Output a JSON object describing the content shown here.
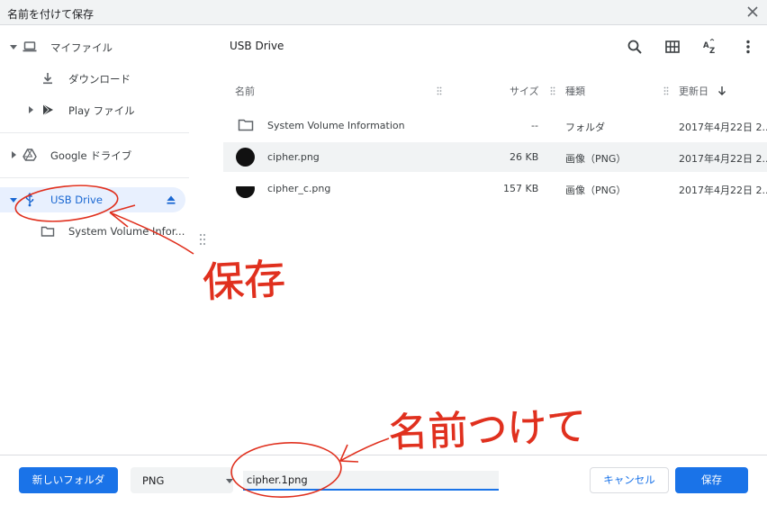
{
  "dialog": {
    "title": "名前を付けて保存"
  },
  "sidebar": {
    "items": [
      {
        "label": "マイファイル"
      },
      {
        "label": "ダウンロード"
      },
      {
        "label": "Play ファイル"
      },
      {
        "label": "Google ドライブ"
      },
      {
        "label": "USB Drive"
      },
      {
        "label": "System Volume Infor..."
      }
    ]
  },
  "main": {
    "path_title": "USB Drive",
    "columns": {
      "name": "名前",
      "size": "サイズ",
      "type": "種類",
      "modified": "更新日"
    },
    "files": [
      {
        "name": "System Volume Information",
        "size": "--",
        "type": "フォルダ",
        "modified": "2017年4月22日 2..."
      },
      {
        "name": "cipher.png",
        "size": "26 KB",
        "type": "画像（PNG）",
        "modified": "2017年4月22日 2..."
      },
      {
        "name": "cipher_c.png",
        "size": "157 KB",
        "type": "画像（PNG）",
        "modified": "2017年4月22日 2..."
      }
    ]
  },
  "footer": {
    "new_folder_label": "新しいフォルダ",
    "filetype_value": "PNG",
    "filename_value": "cipher.1png",
    "cancel_label": "キャンセル",
    "save_label": "保存"
  },
  "colors": {
    "accent": "#1a73e8",
    "annotation": "#e0301e"
  },
  "annotations": {
    "save_note": "保存",
    "name_note": "名前つけて"
  }
}
